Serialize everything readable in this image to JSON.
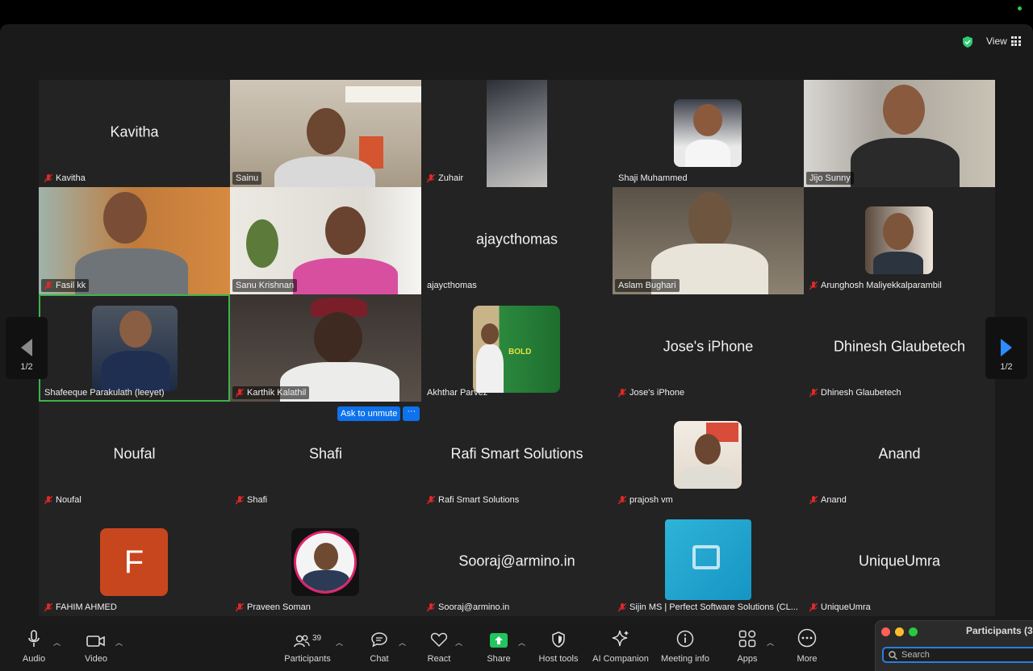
{
  "view": {
    "label": "View"
  },
  "paging": {
    "left": "1/2",
    "right": "1/2"
  },
  "tiles": [
    {
      "name": "Kavitha",
      "big": "Kavitha",
      "muted": true
    },
    {
      "name": "Sainu",
      "muted": false
    },
    {
      "name": "Zuhair",
      "muted": true
    },
    {
      "name": "Shaji Muhammed",
      "muted": false
    },
    {
      "name": "Jijo Sunny",
      "muted": false
    },
    {
      "name": "Fasil kk",
      "muted": true
    },
    {
      "name": "Sanu Krishnan",
      "muted": false
    },
    {
      "name": "ajaycthomas",
      "big": "ajaycthomas",
      "muted": false
    },
    {
      "name": "Aslam Bughari",
      "muted": false
    },
    {
      "name": "Arunghosh Maliyekkalparambil",
      "muted": true
    },
    {
      "name": "Shafeeque Parakulath (leeyet)",
      "muted": false,
      "active": true
    },
    {
      "name": "Karthik Kalathil",
      "muted": true
    },
    {
      "name": "Akhthar Parvez",
      "muted": false
    },
    {
      "name": "Jose's iPhone",
      "big": "Jose's iPhone",
      "muted": true
    },
    {
      "name": "Dhinesh Glaubetech",
      "big": "Dhinesh Glaubetech",
      "muted": true
    },
    {
      "name": "Noufal",
      "big": "Noufal",
      "muted": true
    },
    {
      "name": "Shafi",
      "big": "Shafi",
      "muted": true
    },
    {
      "name": "Rafi Smart Solutions",
      "big": "Rafi Smart Solutions",
      "muted": true
    },
    {
      "name": "prajosh vm",
      "muted": true
    },
    {
      "name": "Anand",
      "big": "Anand",
      "muted": true
    },
    {
      "name": "FAHIM AHMED",
      "muted": true,
      "avatar_letter": "F"
    },
    {
      "name": "Praveen Soman",
      "muted": true
    },
    {
      "name": "Sooraj@armino.in",
      "big": "Sooraj@armino.in",
      "muted": true
    },
    {
      "name": "Sijin MS | Perfect Software Solutions (CL...",
      "muted": true
    },
    {
      "name": "UniqueUmra",
      "big": "UniqueUmra",
      "muted": true
    }
  ],
  "ask_unmute": {
    "label": "Ask to unmute",
    "more": "···"
  },
  "toolbar": {
    "audio": "Audio",
    "video": "Video",
    "participants": "Participants",
    "participants_count": "39",
    "chat": "Chat",
    "react": "React",
    "share": "Share",
    "host_tools": "Host tools",
    "ai_companion": "AI Companion",
    "meeting_info": "Meeting info",
    "apps": "Apps",
    "more": "More"
  },
  "participants_panel": {
    "title": "Participants (3",
    "search_placeholder": "Search"
  },
  "colors": {
    "active_border": "#3bb54a",
    "accent_blue": "#0e72ed",
    "share_green": "#22c55e",
    "mute_red": "#e02828"
  }
}
